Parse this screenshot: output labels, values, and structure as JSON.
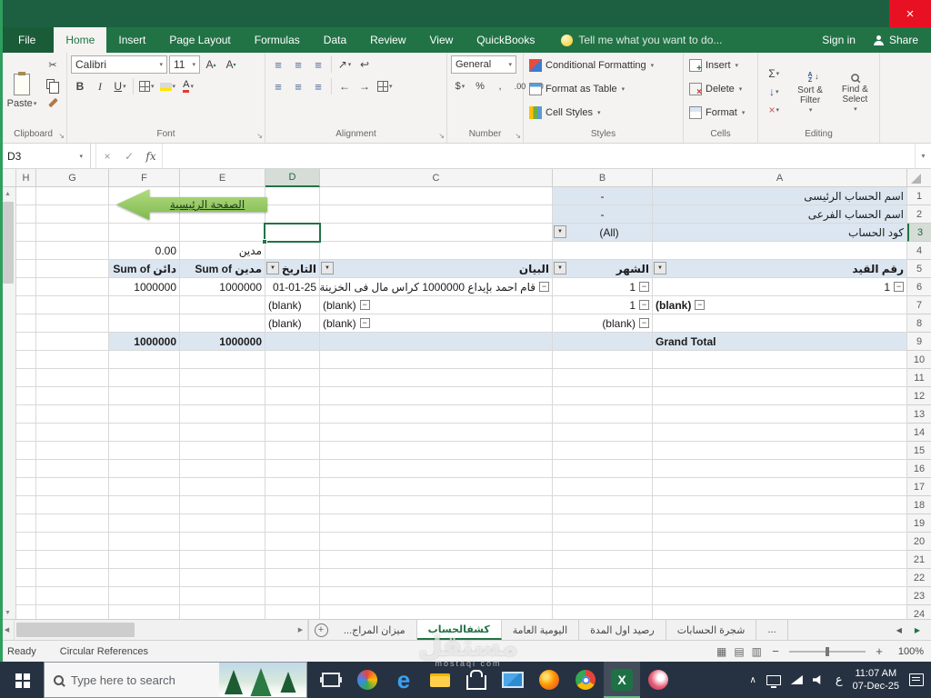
{
  "titlebar": {
    "close": "×"
  },
  "menu": {
    "file": "File",
    "tabs": [
      "Home",
      "Insert",
      "Page Layout",
      "Formulas",
      "Data",
      "Review",
      "View",
      "QuickBooks"
    ],
    "active_tab": "Home",
    "tell_me": "Tell me what you want to do...",
    "sign_in": "Sign in",
    "share": "Share"
  },
  "ribbon": {
    "clipboard": {
      "label": "Clipboard",
      "paste": "Paste"
    },
    "font": {
      "label": "Font",
      "family": "Calibri",
      "size": "11",
      "bold": "B",
      "italic": "I",
      "underline": "U"
    },
    "alignment": {
      "label": "Alignment"
    },
    "number": {
      "label": "Number",
      "format": "General",
      "buttons": [
        "$",
        "%",
        ",",
        ".00",
        ".0"
      ]
    },
    "styles": {
      "label": "Styles",
      "items": [
        "Conditional Formatting",
        "Format as Table",
        "Cell Styles"
      ]
    },
    "cells": {
      "label": "Cells",
      "items": [
        "Insert",
        "Delete",
        "Format"
      ]
    },
    "editing": {
      "label": "Editing",
      "autosum": "Σ",
      "sort_filter": "Sort & Filter",
      "find_select": "Find & Select"
    }
  },
  "formula_bar": {
    "name_box": "D3",
    "fx": "fx",
    "value": ""
  },
  "grid": {
    "columns": [
      "H",
      "G",
      "F",
      "E",
      "D",
      "C",
      "B",
      "A"
    ],
    "selected_column": "D",
    "selected_row": 3,
    "rows": 23,
    "cells": [
      {
        "r": 1,
        "c": "A",
        "t": "اسم الحساب الرئيسى",
        "al": "r",
        "bg": 1
      },
      {
        "r": 1,
        "c": "B",
        "t": "-",
        "al": "c",
        "bg": 1
      },
      {
        "r": 2,
        "c": "A",
        "t": "اسم الحساب الفرعى",
        "al": "r",
        "bg": 1
      },
      {
        "r": 2,
        "c": "B",
        "t": "-",
        "al": "c",
        "bg": 1
      },
      {
        "r": 3,
        "c": "A",
        "t": "كود الحساب",
        "al": "r",
        "bg": 1
      },
      {
        "r": 3,
        "c": "B",
        "t": "(All)",
        "al": "c",
        "bg": 1,
        "dd": 1
      },
      {
        "r": 4,
        "c": "E",
        "t": "مدين",
        "al": "r"
      },
      {
        "r": 4,
        "c": "F",
        "t": "0.00",
        "al": "r"
      },
      {
        "r": 5,
        "c": "A",
        "t": "رقم القيد",
        "al": "r",
        "bg": 1,
        "b": 1,
        "flt": 1
      },
      {
        "r": 5,
        "c": "B",
        "t": "الشهر",
        "al": "r",
        "bg": 1,
        "b": 1,
        "flt": 1
      },
      {
        "r": 5,
        "c": "C",
        "t": "البيان",
        "al": "r",
        "bg": 1,
        "b": 1,
        "flt": 1
      },
      {
        "r": 5,
        "c": "D",
        "t": "التاريخ",
        "al": "r",
        "bg": 1,
        "b": 1,
        "flt": 1
      },
      {
        "r": 5,
        "c": "E",
        "t": "Sum of مدين",
        "al": "r",
        "bg": 1,
        "b": 1
      },
      {
        "r": 5,
        "c": "F",
        "t": "Sum of دائن",
        "al": "r",
        "bg": 1,
        "b": 1
      },
      {
        "r": 6,
        "c": "A",
        "t": "1",
        "al": "r",
        "box": 1
      },
      {
        "r": 6,
        "c": "B",
        "t": "1",
        "al": "r",
        "box": 1
      },
      {
        "r": 6,
        "c": "C",
        "t": "قام احمد بإيداع 1000000 كراس مال فى الخزينة",
        "al": "r",
        "box": 1
      },
      {
        "r": 6,
        "c": "D",
        "t": "01-01-25",
        "al": "r"
      },
      {
        "r": 6,
        "c": "E",
        "t": "1000000",
        "al": "r"
      },
      {
        "r": 6,
        "c": "F",
        "t": "1000000",
        "al": "r"
      },
      {
        "r": 7,
        "c": "A",
        "t": "(blank)",
        "al": "l",
        "b": 1,
        "box": 1
      },
      {
        "r": 7,
        "c": "B",
        "t": "1",
        "al": "r",
        "box": 1
      },
      {
        "r": 7,
        "c": "C",
        "t": "(blank)",
        "al": "l",
        "box": 1
      },
      {
        "r": 7,
        "c": "D",
        "t": "(blank)",
        "al": "l"
      },
      {
        "r": 8,
        "c": "B",
        "t": "(blank)",
        "al": "r",
        "box": 1
      },
      {
        "r": 8,
        "c": "C",
        "t": "(blank)",
        "al": "l",
        "box": 1
      },
      {
        "r": 8,
        "c": "D",
        "t": "(blank)",
        "al": "l"
      },
      {
        "r": 9,
        "c": "A",
        "t": "Grand Total",
        "al": "l",
        "bg": 1,
        "b": 1
      },
      {
        "r": 9,
        "c": "B",
        "bg": 1
      },
      {
        "r": 9,
        "c": "C",
        "bg": 1
      },
      {
        "r": 9,
        "c": "D",
        "bg": 1
      },
      {
        "r": 9,
        "c": "E",
        "t": "1000000",
        "al": "r",
        "bg": 1,
        "b": 1
      },
      {
        "r": 9,
        "c": "F",
        "t": "1000000",
        "al": "r",
        "bg": 1,
        "b": 1
      }
    ]
  },
  "shape": {
    "label": "الصفحة الرئيسية"
  },
  "sheet_tabs": {
    "tabs": [
      "ميزان المراج...",
      "كشفالحساب",
      "اليومية العامة",
      "رصيد اول المدة",
      "شجرة الحسابات",
      "..."
    ],
    "active": "كشفالحساب",
    "add": "+"
  },
  "status_bar": {
    "ready": "Ready",
    "circular": "Circular References",
    "zoom": "100%"
  },
  "taskbar": {
    "search_placeholder": "Type here to search",
    "icons": [
      "task-view",
      "photos",
      "edge",
      "file-explorer",
      "store",
      "mail",
      "firefox",
      "chrome",
      "excel",
      "paint"
    ],
    "lang": "ع",
    "time": "11:07 AM",
    "date": "07-Dec-25"
  },
  "watermark": {
    "text": "مستقل",
    "sub": "mostaql com"
  },
  "colors": {
    "excel_green": "#217346",
    "selection_border": "#217346",
    "pivot_fill_blue": "#DCE6F1",
    "arrow_fill": "#8CC152",
    "close_red": "#E81123",
    "taskbar": "#263241"
  }
}
